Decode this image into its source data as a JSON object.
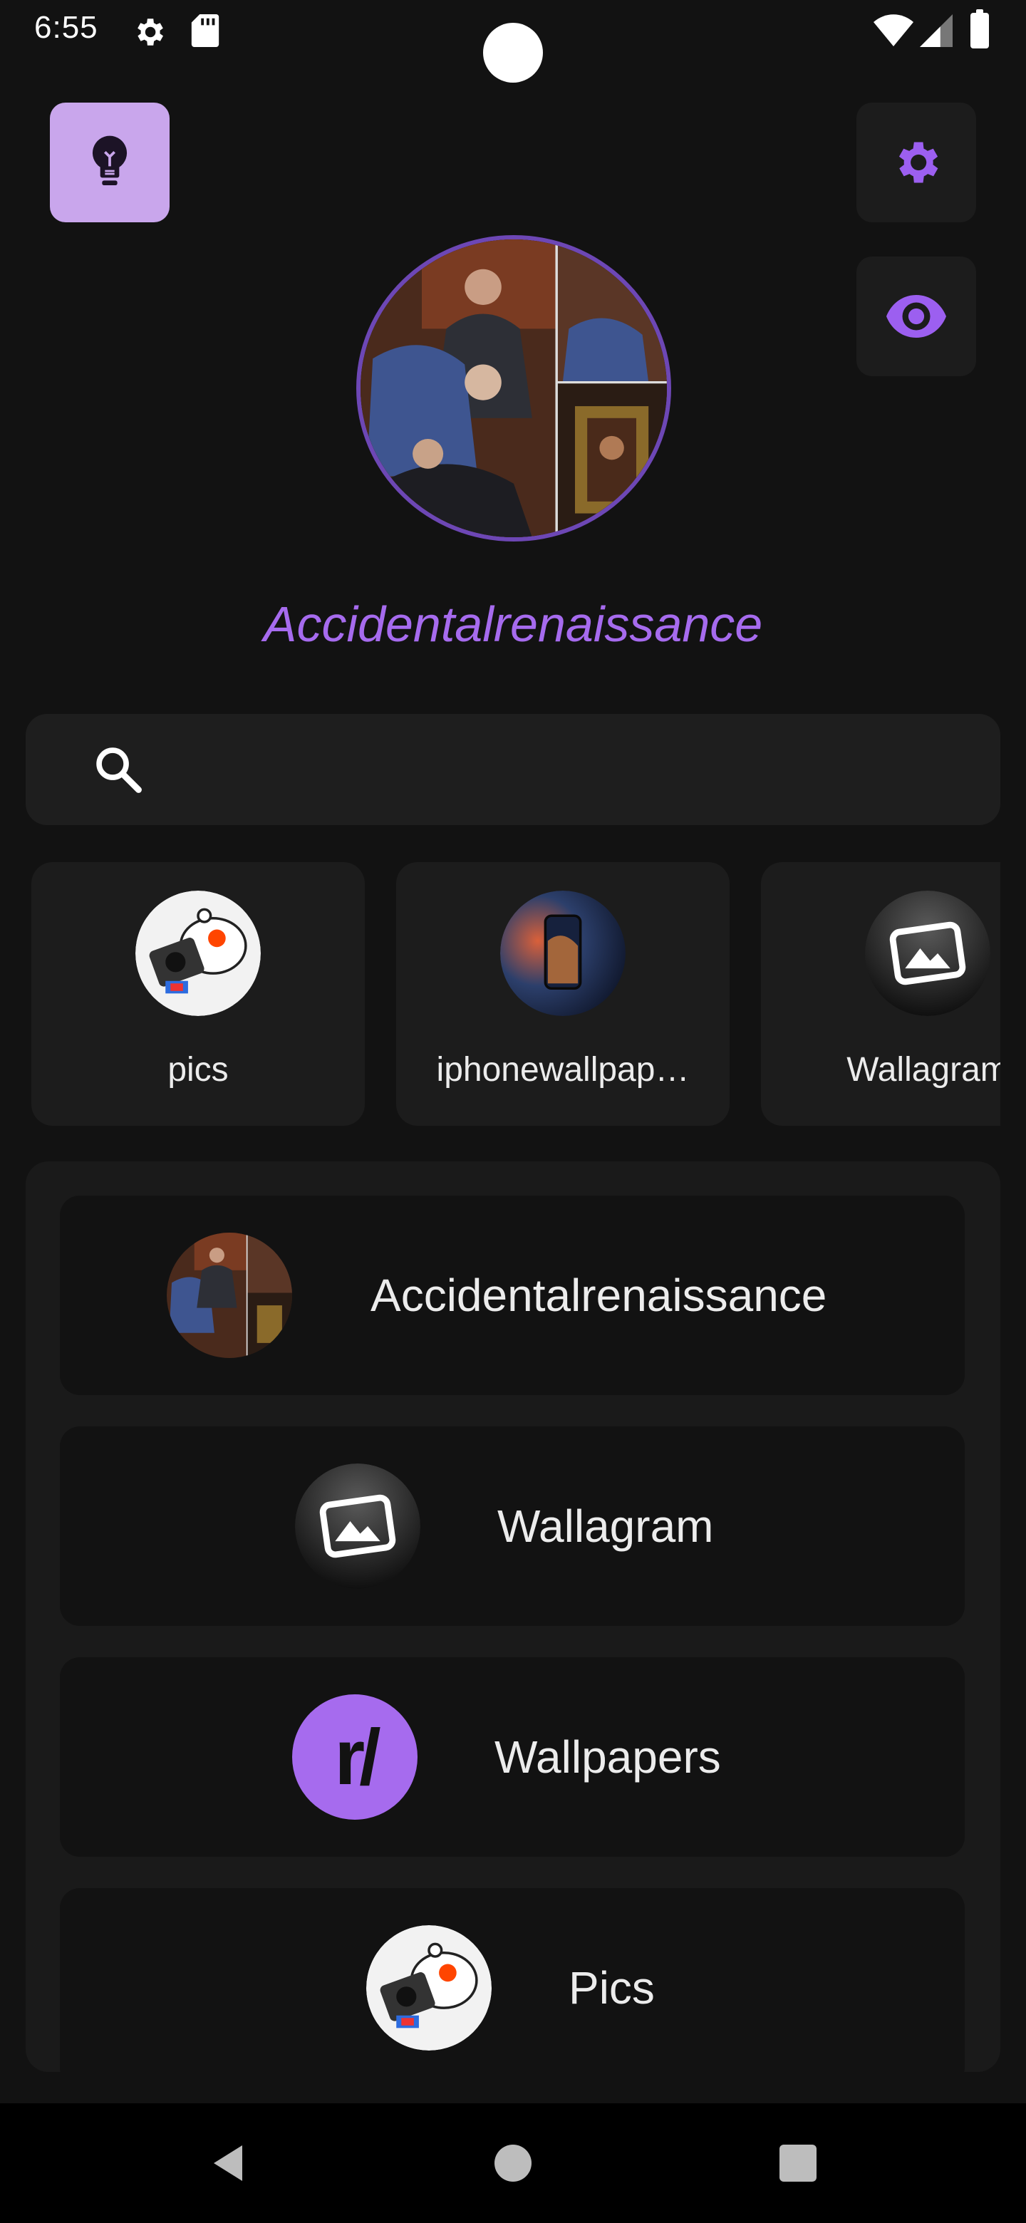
{
  "status_bar": {
    "time": "6:55",
    "icons": [
      "gear-icon",
      "sd-card-icon",
      "wifi-icon",
      "signal-icon",
      "battery-icon"
    ]
  },
  "colors": {
    "background": "#121212",
    "accent": "#a66bee",
    "tip_button": "#c9a6ec",
    "card": "#1c1c1c"
  },
  "top_buttons": [
    {
      "name": "tip-button",
      "icon": "lightbulb-icon"
    },
    {
      "name": "settings-button",
      "icon": "gear-icon"
    },
    {
      "name": "preview-button",
      "icon": "eye-icon"
    }
  ],
  "profile": {
    "title": "Accidentalrenaissance"
  },
  "search": {
    "placeholder": "",
    "value": ""
  },
  "chips": [
    {
      "label": "pics",
      "icon": "reddit-camera-icon"
    },
    {
      "label": "iphonewallpap…",
      "icon": "phone-wallpaper-icon"
    },
    {
      "label": "Wallagram",
      "icon": "image-frame-icon"
    }
  ],
  "list": [
    {
      "label": "Accidentalrenaissance",
      "icon": "renaissance-collage-icon"
    },
    {
      "label": "Wallagram",
      "icon": "image-frame-icon"
    },
    {
      "label": "Wallpapers",
      "icon": "subreddit-r-icon",
      "icon_text": "r/"
    },
    {
      "label": "Pics",
      "icon": "reddit-camera-icon"
    }
  ]
}
